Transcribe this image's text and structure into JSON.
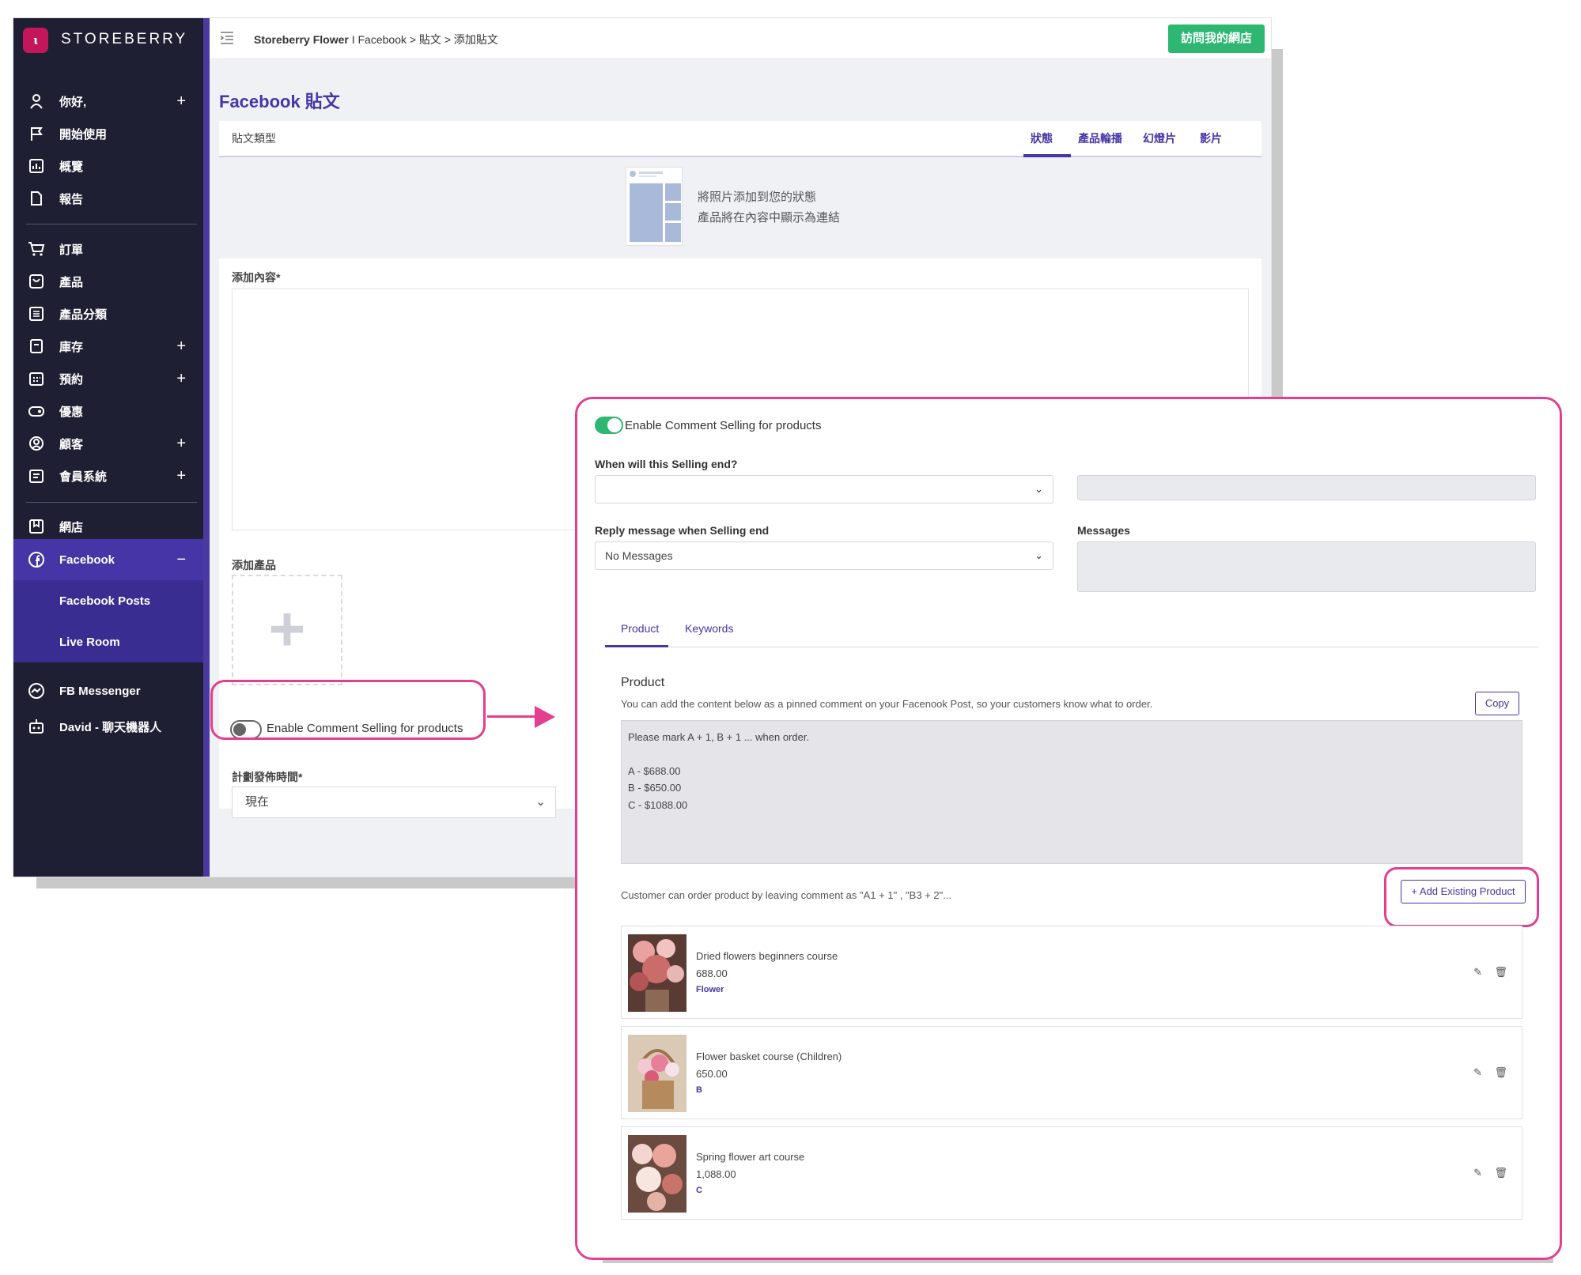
{
  "app": {
    "logo_mark": "ꙇ",
    "brand": "STOREBERRY"
  },
  "sidebar": {
    "items": [
      {
        "label": "你好,",
        "icon": "user-icon",
        "plus": "+"
      },
      {
        "label": "開始使用",
        "icon": "flag-icon"
      },
      {
        "label": "概覽",
        "icon": "chart-icon"
      },
      {
        "label": "報告",
        "icon": "document-icon"
      },
      {
        "label": "訂單",
        "icon": "cart-icon"
      },
      {
        "label": "產品",
        "icon": "bag-icon"
      },
      {
        "label": "產品分類",
        "icon": "list-icon"
      },
      {
        "label": "庫存",
        "icon": "inventory-icon",
        "plus": "+"
      },
      {
        "label": "預約",
        "icon": "calendar-icon",
        "plus": "+"
      },
      {
        "label": "優惠",
        "icon": "coupon-icon"
      },
      {
        "label": "顧客",
        "icon": "customer-icon",
        "plus": "+"
      },
      {
        "label": "會員系統",
        "icon": "member-icon",
        "plus": "+"
      },
      {
        "label": "網店",
        "icon": "store-icon"
      },
      {
        "label": "Facebook",
        "icon": "facebook-icon",
        "plus": "−"
      },
      {
        "label": "Facebook Posts"
      },
      {
        "label": "Live Room"
      },
      {
        "label": "FB Messenger",
        "icon": "messenger-icon"
      },
      {
        "label": "David - 聊天機器人",
        "icon": "robot-icon"
      }
    ]
  },
  "topbar": {
    "crumb_store": "Storeberry Flower",
    "crumb_rest": " I Facebook > 貼文 > 添加貼文",
    "visit_button": "訪問我的網店"
  },
  "page": {
    "title": "Facebook 貼文",
    "post_type_label": "貼文類型",
    "tabs": [
      "狀態",
      "產品輪播",
      "幻燈片",
      "影片"
    ],
    "preview_line1": "將照片添加到您的狀態",
    "preview_line2": "產品將在內容中顯示為連結",
    "content_label": "添加內容*",
    "add_product_label": "添加產品",
    "add_product_plus": "+",
    "toggle_label": "Enable Comment Selling for products",
    "schedule_label": "計劃發佈時間*",
    "schedule_value": "現在"
  },
  "panel": {
    "toggle_label": "Enable Comment Selling for products",
    "end_label": "When will this Selling end?",
    "end_value": "",
    "reply_label": "Reply message when Selling end",
    "reply_value": "No Messages",
    "messages_label": "Messages",
    "tabs": [
      "Product",
      "Keywords"
    ],
    "product_heading": "Product",
    "product_desc": "You can add the content below as a pinned comment on your Facenook Post, so your customers know what to order.",
    "copy_button": "Copy",
    "pinned_lines": [
      "Please mark A + 1, B + 1 ... when order.",
      "",
      "A -  $688.00",
      "B -  $650.00",
      "C -  $1088.00"
    ],
    "customer_note": "Customer can order product by leaving comment as \"A1 + 1\" , \"B3 + 2\"...",
    "add_existing_button": "+ Add Existing Product",
    "products": [
      {
        "name": "Dried flowers beginners course",
        "price": "688.00",
        "tag": "Flower"
      },
      {
        "name": "Flower basket course (Children)",
        "price": "650.00",
        "tag": "B"
      },
      {
        "name": "Spring flower art course",
        "price": "1,088.00",
        "tag": "C"
      }
    ]
  },
  "colors": {
    "accent": "#4535a6",
    "highlight": "#e53d8f",
    "green": "#2eb673",
    "sidebar": "#1f1f33"
  }
}
